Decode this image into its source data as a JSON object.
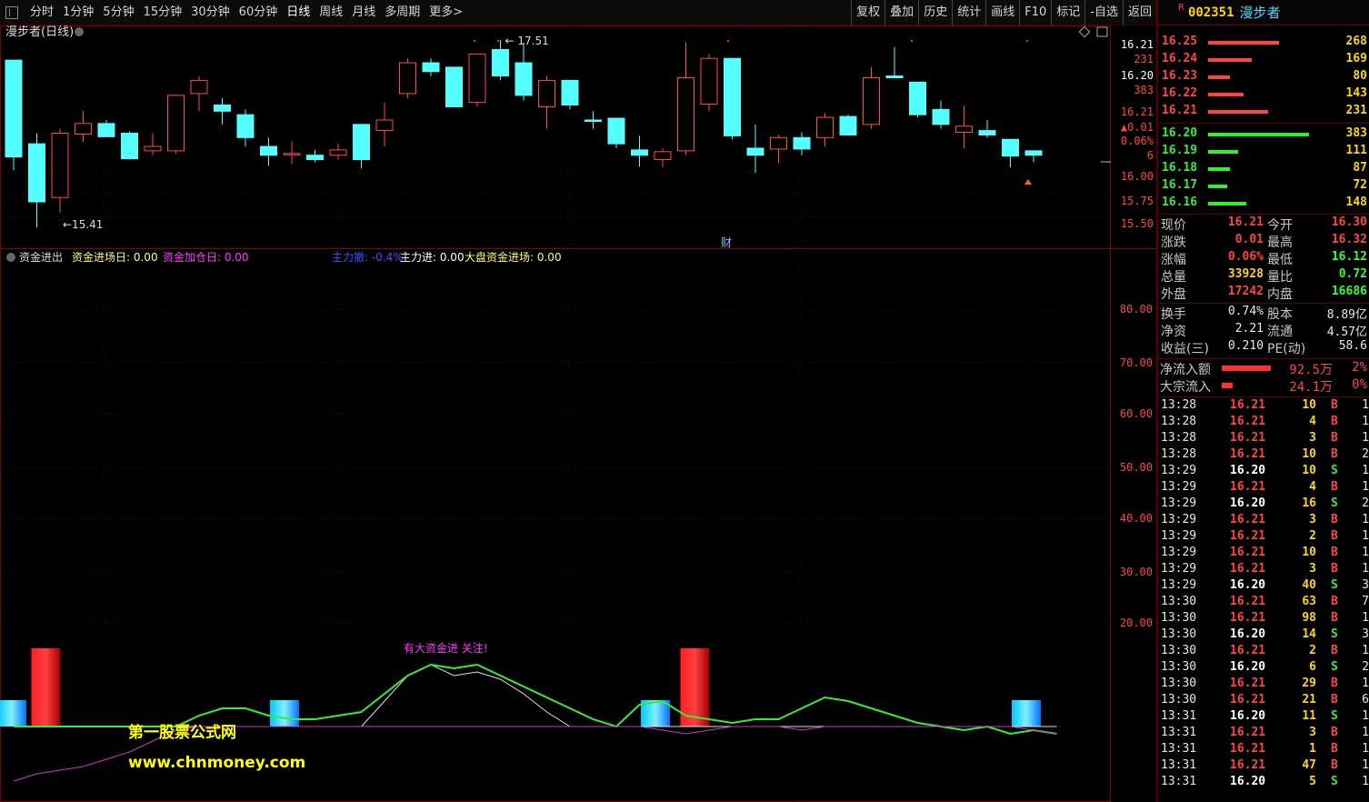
{
  "toolbar": {
    "periods": [
      "分时",
      "1分钟",
      "5分钟",
      "15分钟",
      "30分钟",
      "60分钟",
      "日线",
      "周线",
      "月线",
      "多周期",
      "更多>"
    ],
    "active_period": "日线",
    "actions": [
      "复权",
      "叠加",
      "历史",
      "统计",
      "画线",
      "F10",
      "标记",
      "-自选",
      "返回"
    ]
  },
  "kline": {
    "title": "漫步者(日线)",
    "price_axis": [
      "16.21",
      "16.20",
      "16.00",
      "15.75",
      "15.50"
    ],
    "axis_extra": [
      "231",
      "383",
      "16.21",
      "▲0.01",
      "0.06%",
      "6"
    ],
    "high_label": "17.51",
    "low_label": "15.41",
    "marker_text": "财",
    "colors": {
      "up": "#ff4a4a",
      "down": "#54ffff"
    },
    "candles": [
      {
        "o": 17.28,
        "h": 17.28,
        "l": 16.03,
        "c": 16.18
      },
      {
        "o": 16.33,
        "h": 16.45,
        "l": 15.38,
        "c": 15.67
      },
      {
        "o": 15.72,
        "h": 16.5,
        "l": 15.55,
        "c": 16.45
      },
      {
        "o": 16.44,
        "h": 16.7,
        "l": 16.35,
        "c": 16.56
      },
      {
        "o": 16.56,
        "h": 16.6,
        "l": 16.42,
        "c": 16.41
      },
      {
        "o": 16.45,
        "h": 16.47,
        "l": 16.15,
        "c": 16.16
      },
      {
        "o": 16.25,
        "h": 16.45,
        "l": 16.2,
        "c": 16.3
      },
      {
        "o": 16.25,
        "h": 16.89,
        "l": 16.22,
        "c": 16.88
      },
      {
        "o": 16.9,
        "h": 17.1,
        "l": 16.7,
        "c": 17.05
      },
      {
        "o": 16.77,
        "h": 16.85,
        "l": 16.55,
        "c": 16.7
      },
      {
        "o": 16.66,
        "h": 16.72,
        "l": 16.3,
        "c": 16.4
      },
      {
        "o": 16.3,
        "h": 16.4,
        "l": 16.08,
        "c": 16.2
      },
      {
        "o": 16.22,
        "h": 16.36,
        "l": 16.1,
        "c": 16.22
      },
      {
        "o": 16.2,
        "h": 16.26,
        "l": 16.12,
        "c": 16.15
      },
      {
        "o": 16.2,
        "h": 16.33,
        "l": 16.15,
        "c": 16.26
      },
      {
        "o": 16.55,
        "h": 16.55,
        "l": 16.05,
        "c": 16.15
      },
      {
        "o": 16.48,
        "h": 16.8,
        "l": 16.3,
        "c": 16.6
      },
      {
        "o": 16.9,
        "h": 17.3,
        "l": 16.85,
        "c": 17.25
      },
      {
        "o": 17.25,
        "h": 17.3,
        "l": 17.1,
        "c": 17.15
      },
      {
        "o": 17.2,
        "h": 17.2,
        "l": 16.75,
        "c": 16.75
      },
      {
        "o": 16.8,
        "h": 17.3,
        "l": 16.75,
        "c": 17.35
      },
      {
        "o": 17.4,
        "h": 17.51,
        "l": 17.05,
        "c": 17.1
      },
      {
        "o": 17.25,
        "h": 17.48,
        "l": 16.82,
        "c": 16.88
      },
      {
        "o": 16.75,
        "h": 17.1,
        "l": 16.5,
        "c": 17.05
      },
      {
        "o": 17.05,
        "h": 17.05,
        "l": 16.72,
        "c": 16.77
      },
      {
        "o": 16.6,
        "h": 16.7,
        "l": 16.5,
        "c": 16.59
      },
      {
        "o": 16.62,
        "h": 16.62,
        "l": 16.28,
        "c": 16.33
      },
      {
        "o": 16.26,
        "h": 16.42,
        "l": 16.07,
        "c": 16.2
      },
      {
        "o": 16.15,
        "h": 16.28,
        "l": 16.06,
        "c": 16.24
      },
      {
        "o": 16.25,
        "h": 17.48,
        "l": 16.2,
        "c": 17.08
      },
      {
        "o": 16.78,
        "h": 17.35,
        "l": 16.7,
        "c": 17.3
      },
      {
        "o": 17.3,
        "h": 17.3,
        "l": 16.38,
        "c": 16.42
      },
      {
        "o": 16.28,
        "h": 16.55,
        "l": 16.0,
        "c": 16.2
      },
      {
        "o": 16.27,
        "h": 16.43,
        "l": 16.11,
        "c": 16.4
      },
      {
        "o": 16.4,
        "h": 16.46,
        "l": 16.2,
        "c": 16.27
      },
      {
        "o": 16.4,
        "h": 16.68,
        "l": 16.3,
        "c": 16.63
      },
      {
        "o": 16.64,
        "h": 16.66,
        "l": 16.42,
        "c": 16.43
      },
      {
        "o": 16.55,
        "h": 17.2,
        "l": 16.5,
        "c": 17.08
      },
      {
        "o": 17.1,
        "h": 17.43,
        "l": 17.08,
        "c": 17.08
      },
      {
        "o": 17.03,
        "h": 17.03,
        "l": 16.63,
        "c": 16.66
      },
      {
        "o": 16.72,
        "h": 16.82,
        "l": 16.5,
        "c": 16.55
      },
      {
        "o": 16.46,
        "h": 16.76,
        "l": 16.28,
        "c": 16.53
      },
      {
        "o": 16.48,
        "h": 16.6,
        "l": 16.4,
        "c": 16.43
      },
      {
        "o": 16.38,
        "h": 16.38,
        "l": 16.06,
        "c": 16.19
      },
      {
        "o": 16.25,
        "h": 16.25,
        "l": 16.12,
        "c": 16.2
      }
    ]
  },
  "indicator": {
    "name": "资金进出",
    "legend": [
      {
        "text": "资金进场日: 0.00",
        "color": "#ffff66"
      },
      {
        "text": "资金加仓日: 0.00",
        "color": "#ff33ff"
      },
      {
        "text": "主力撤: -0.4%",
        "color": "#3355ff"
      },
      {
        "text": "主力进: 0.00",
        "color": "#ffffff"
      },
      {
        "text": "大盘资金进场: 0.00",
        "color": "#ffff66"
      }
    ],
    "axis": [
      "80.00",
      "70.00",
      "60.00",
      "50.00",
      "40.00",
      "30.00",
      "20.00"
    ],
    "annotation": "有大资金进 关注!",
    "watermark_cn": "第一股票公式网",
    "watermark_url": "www.chnmoney.com",
    "red_bars": [
      1,
      29
    ],
    "cyan_bars": [
      0,
      12,
      28,
      44
    ],
    "green_line": [
      0,
      0,
      0,
      0,
      0,
      0,
      0,
      0,
      3,
      5,
      5,
      3,
      2,
      2,
      3,
      4,
      9,
      14,
      17,
      16,
      17,
      14,
      11,
      8,
      5,
      2,
      0,
      6,
      7,
      3,
      2,
      1,
      2,
      2,
      5,
      8,
      7,
      5,
      3,
      1,
      0,
      -1,
      0,
      -2,
      -1,
      -2
    ],
    "white_line": [
      0,
      0,
      0,
      0,
      0,
      0,
      0,
      0,
      0,
      0,
      0,
      0,
      0,
      0,
      0,
      0,
      7,
      14,
      17,
      14,
      15,
      13,
      9,
      4,
      0,
      0,
      0,
      0,
      0,
      0,
      0,
      0,
      0,
      0,
      0,
      0,
      0,
      0,
      0,
      0,
      0,
      0,
      0,
      0,
      0,
      0
    ],
    "magenta_line": [
      -15,
      -13,
      -12,
      -11,
      -9,
      -7,
      -4,
      -1,
      0,
      0,
      0,
      0,
      0,
      0,
      0,
      0,
      0,
      0,
      0,
      0,
      0,
      0,
      0,
      0,
      0,
      0,
      0,
      0,
      -1,
      -2,
      -1,
      0,
      0,
      0,
      -1,
      0,
      0,
      0,
      0,
      0,
      0,
      0,
      0,
      0,
      -1,
      -2
    ]
  },
  "quote": {
    "code": "002351",
    "name": "漫步者",
    "asks": [
      {
        "price": "16.25",
        "vol": "268",
        "bar": 0.26
      },
      {
        "price": "16.24",
        "vol": "169",
        "bar": 0.16
      },
      {
        "price": "16.23",
        "vol": "80",
        "bar": 0.08
      },
      {
        "price": "16.22",
        "vol": "143",
        "bar": 0.13
      },
      {
        "price": "16.21",
        "vol": "231",
        "bar": 0.22
      }
    ],
    "bids": [
      {
        "price": "16.20",
        "vol": "383",
        "bar": 0.37
      },
      {
        "price": "16.19",
        "vol": "111",
        "bar": 0.11
      },
      {
        "price": "16.18",
        "vol": "87",
        "bar": 0.08
      },
      {
        "price": "16.17",
        "vol": "72",
        "bar": 0.07
      },
      {
        "price": "16.16",
        "vol": "148",
        "bar": 0.14
      }
    ],
    "stats": [
      {
        "k1": "现价",
        "v1": "16.21",
        "c1": "#ff4444",
        "k2": "今开",
        "v2": "16.30",
        "c2": "#ff4444"
      },
      {
        "k1": "涨跌",
        "v1": "0.01",
        "c1": "#ff4444",
        "k2": "最高",
        "v2": "16.32",
        "c2": "#ff4444"
      },
      {
        "k1": "涨幅",
        "v1": "0.06%",
        "c1": "#ff4444",
        "k2": "最低",
        "v2": "16.12",
        "c2": "#33ff33"
      },
      {
        "k1": "总量",
        "v1": "33928",
        "c1": "#ffd700",
        "k2": "量比",
        "v2": "0.72",
        "c2": "#33ff33"
      },
      {
        "k1": "外盘",
        "v1": "17242",
        "c1": "#ff4444",
        "k2": "内盘",
        "v2": "16686",
        "c2": "#33ff33"
      }
    ],
    "stats2": [
      {
        "k1": "换手",
        "v1": "0.74%",
        "k2": "股本",
        "v2": "8.89亿"
      },
      {
        "k1": "净资",
        "v1": "2.21",
        "k2": "流通",
        "v2": "4.57亿"
      },
      {
        "k1": "收益(三)",
        "v1": "0.210",
        "k2": "PE(动)",
        "v2": "58.6"
      }
    ],
    "flows": [
      {
        "label": "净流入额",
        "bar": 0.9,
        "value": "92.5万",
        "pct": "2%"
      },
      {
        "label": "大宗流入",
        "bar": 0.2,
        "value": "24.1万",
        "pct": "0%"
      }
    ],
    "ticks": [
      {
        "t": "13:28",
        "p": "16.21",
        "v": "10",
        "s": "B",
        "n": "1"
      },
      {
        "t": "13:28",
        "p": "16.21",
        "v": "4",
        "s": "B",
        "n": "1"
      },
      {
        "t": "13:28",
        "p": "16.21",
        "v": "3",
        "s": "B",
        "n": "1"
      },
      {
        "t": "13:28",
        "p": "16.21",
        "v": "10",
        "s": "B",
        "n": "2"
      },
      {
        "t": "13:29",
        "p": "16.20",
        "v": "10",
        "s": "S",
        "n": "1"
      },
      {
        "t": "13:29",
        "p": "16.21",
        "v": "4",
        "s": "B",
        "n": "1"
      },
      {
        "t": "13:29",
        "p": "16.20",
        "v": "16",
        "s": "S",
        "n": "2"
      },
      {
        "t": "13:29",
        "p": "16.21",
        "v": "3",
        "s": "B",
        "n": "1"
      },
      {
        "t": "13:29",
        "p": "16.21",
        "v": "2",
        "s": "B",
        "n": "1"
      },
      {
        "t": "13:29",
        "p": "16.21",
        "v": "10",
        "s": "B",
        "n": "1"
      },
      {
        "t": "13:29",
        "p": "16.21",
        "v": "3",
        "s": "B",
        "n": "1"
      },
      {
        "t": "13:29",
        "p": "16.20",
        "v": "40",
        "s": "S",
        "n": "3"
      },
      {
        "t": "13:30",
        "p": "16.21",
        "v": "63",
        "s": "B",
        "n": "7"
      },
      {
        "t": "13:30",
        "p": "16.21",
        "v": "98",
        "s": "B",
        "n": "1"
      },
      {
        "t": "13:30",
        "p": "16.20",
        "v": "14",
        "s": "S",
        "n": "3"
      },
      {
        "t": "13:30",
        "p": "16.21",
        "v": "2",
        "s": "B",
        "n": "1"
      },
      {
        "t": "13:30",
        "p": "16.20",
        "v": "6",
        "s": "S",
        "n": "2"
      },
      {
        "t": "13:30",
        "p": "16.21",
        "v": "29",
        "s": "B",
        "n": "1"
      },
      {
        "t": "13:30",
        "p": "16.21",
        "v": "21",
        "s": "B",
        "n": "6"
      },
      {
        "t": "13:31",
        "p": "16.20",
        "v": "11",
        "s": "S",
        "n": "1"
      },
      {
        "t": "13:31",
        "p": "16.21",
        "v": "3",
        "s": "B",
        "n": "1"
      },
      {
        "t": "13:31",
        "p": "16.21",
        "v": "1",
        "s": "B",
        "n": "1"
      },
      {
        "t": "13:31",
        "p": "16.21",
        "v": "47",
        "s": "B",
        "n": "1"
      },
      {
        "t": "13:31",
        "p": "16.20",
        "v": "5",
        "s": "S",
        "n": "1"
      }
    ]
  }
}
